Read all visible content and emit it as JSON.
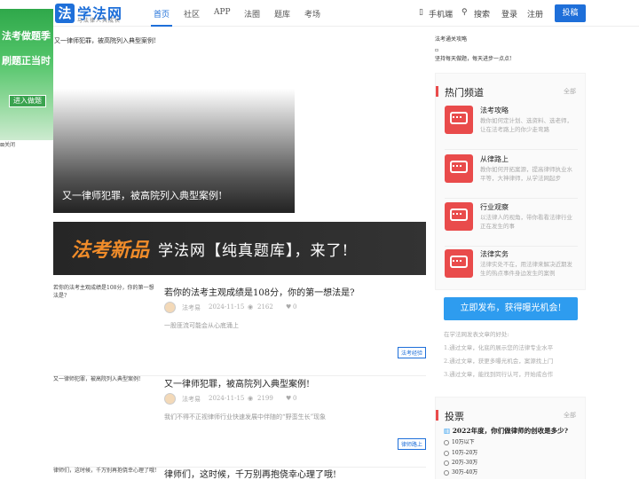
{
  "header": {
    "logo_char": "法",
    "brand": "学法网",
    "slogan": "与法律人共成长",
    "nav": [
      "首页",
      "社区",
      "APP",
      "法圈",
      "题库",
      "考场"
    ],
    "mobile": "手机端",
    "search": "搜索",
    "login": "登录",
    "register": "注册",
    "submit": "投稿",
    "accent": "#1e6fd9"
  },
  "ad": {
    "line1": "法考做题季",
    "line2": "刷题正当时",
    "button": "进入做题",
    "close": "关闭"
  },
  "hero": {
    "alt": "又一律师犯罪，被高院列入典型案例!",
    "caption": "又一律师犯罪，被高院列入典型案例!"
  },
  "banner": {
    "left": "法考新品",
    "right": "学法网【纯真题库】，来了!"
  },
  "articles": [
    {
      "thumb": "若你的法考主观成绩是108分，你的第一想法是?",
      "title": "若你的法考主观成绩是108分，你的第一想法是?",
      "author": "法考易",
      "date": "2024-11-15",
      "views": "2162",
      "likes": "0",
      "desc": "一股匪流可能会从心底涌上",
      "tag": "法考经验"
    },
    {
      "thumb": "又一律师犯罪，被高院列入典型案例!",
      "title": "又一律师犯罪，被高院列入典型案例!",
      "author": "法考易",
      "date": "2024-11-15",
      "views": "2199",
      "likes": "0",
      "desc": "我们不得不正视律师行业快速发展中伴随的“野蛮生长”现象",
      "tag": "律师路上"
    },
    {
      "thumb": "律师们，这时候，千万别再抱侥幸心理了哦!",
      "title": "律师们，这时候，千万别再抱侥幸心理了哦!"
    }
  ],
  "side_top": [
    "法考通关攻略",
    "",
    "坚持每天做题，每天进步一点点!"
  ],
  "hot": {
    "title": "热门频道",
    "more": "全部",
    "items": [
      {
        "name": "法考攻略",
        "desc": "教你如何定计划、选资料、选老师，让在法考路上的你少走弯路"
      },
      {
        "name": "从律路上",
        "desc": "教你如何开拓案源，提高律师执业水平等，大神律师，从学法网起步"
      },
      {
        "name": "行业观察",
        "desc": "以法律人的视角，带你看看法律行业正在发生的事"
      },
      {
        "name": "法律实务",
        "desc": "法律实处不在，用法律来解决近期发生的热点事件身边发生的案例"
      }
    ]
  },
  "publish": "立即发布，获得曝光机会!",
  "tips": [
    "在学法网发表文章的好处:",
    "1.通过文章，化底的展示您的法律专业水平",
    "2.通过文章，获更多曝光机会，案源找上门",
    "3.通过文章，能找到同行认可，开始成合作"
  ],
  "poll": {
    "title": "投票",
    "more": "全部",
    "question": "2022年度，你们做律师的创收是多少?",
    "options": [
      "10万以下",
      "10万-20万",
      "20万-30万",
      "30万-40万"
    ]
  }
}
